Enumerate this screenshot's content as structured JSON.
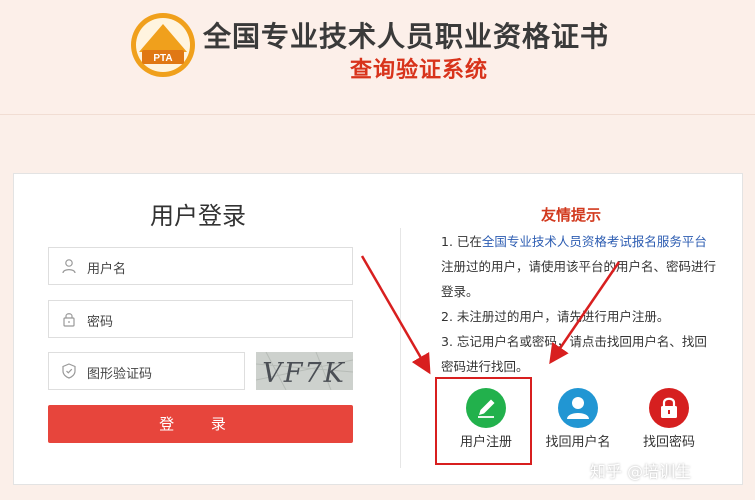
{
  "header": {
    "logo_text": "PTA",
    "title": "全国专业技术人员职业资格证书",
    "subtitle": "查询验证系统"
  },
  "login": {
    "title": "用户登录",
    "username_label": "用户名",
    "password_label": "密码",
    "captcha_label": "图形验证码",
    "captcha_text": "VF7K",
    "login_button": "登 录"
  },
  "tips": {
    "title": "友情提示",
    "line1_prefix": "1. 已在",
    "line1_link": "全国专业技术人员资格考试报名服务平台",
    "line2": "注册过的用户，请使用该平台的用户名、密码进行",
    "line3": "登录。",
    "line4": "2. 未注册过的用户，请先进行用户注册。",
    "line5": "3. 忘记用户名或密码，请点击找回用户名、找回",
    "line6": "密码进行找回。"
  },
  "actions": {
    "register": "用户注册",
    "find_username": "找回用户名",
    "find_password": "找回密码"
  },
  "watermark": "知乎 @培训生",
  "colors": {
    "accent_red": "#e7453c",
    "title_red": "#d8331b",
    "register_green": "#22b14c",
    "username_blue": "#2196d3",
    "password_red": "#d61f1f",
    "link_blue": "#2d5db2"
  }
}
